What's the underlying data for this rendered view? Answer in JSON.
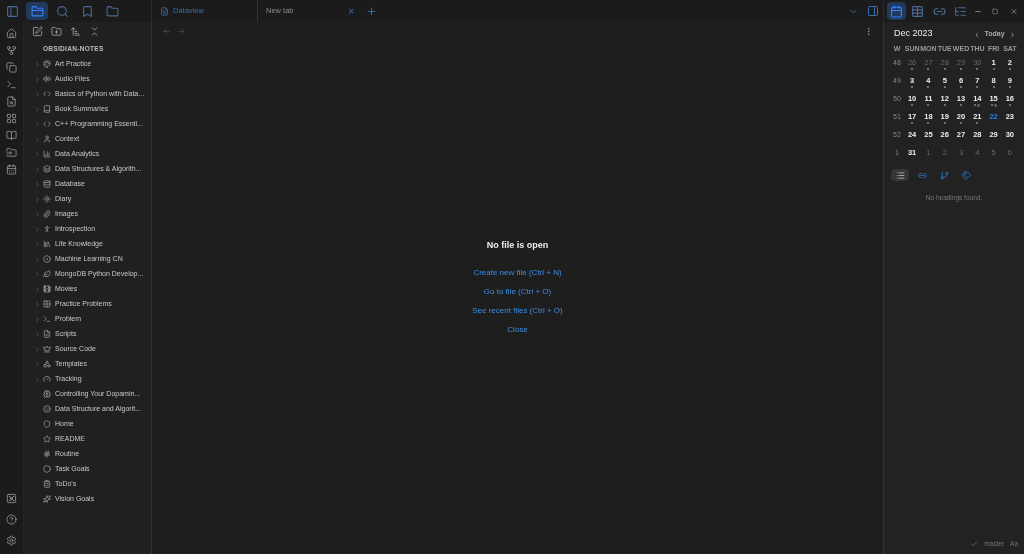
{
  "tabs": [
    {
      "label": "Dataview",
      "selected": false
    },
    {
      "label": "New tab",
      "selected": true,
      "close": "×"
    }
  ],
  "vault": {
    "name": "OBSIDIAN-NOTES"
  },
  "tree": [
    {
      "label": "Art Practice",
      "kind": "folder",
      "expanded": false
    },
    {
      "label": "Audio Files",
      "kind": "folder",
      "expanded": false
    },
    {
      "label": "Basics of Python with Data...",
      "kind": "folder",
      "expanded": false
    },
    {
      "label": "Book Summaries",
      "kind": "folder",
      "expanded": false
    },
    {
      "label": "C++ Programming Essenti...",
      "kind": "folder",
      "expanded": false
    },
    {
      "label": "Context",
      "kind": "folder",
      "expanded": false
    },
    {
      "label": "Data Analytics",
      "kind": "folder",
      "expanded": false
    },
    {
      "label": "Data Structures & Algorith...",
      "kind": "folder",
      "expanded": false
    },
    {
      "label": "Database",
      "kind": "folder",
      "expanded": false
    },
    {
      "label": "Diary",
      "kind": "folder",
      "expanded": false
    },
    {
      "label": "Images",
      "kind": "folder",
      "expanded": false
    },
    {
      "label": "Introspection",
      "kind": "folder",
      "expanded": false
    },
    {
      "label": "Life Knowledge",
      "kind": "folder",
      "expanded": false
    },
    {
      "label": "Machine Learning CN",
      "kind": "folder",
      "expanded": false
    },
    {
      "label": "MongoDB Python Develop...",
      "kind": "folder",
      "expanded": false
    },
    {
      "label": "Movies",
      "kind": "folder",
      "expanded": false
    },
    {
      "label": "Practice Problems",
      "kind": "folder",
      "expanded": false
    },
    {
      "label": "Problem",
      "kind": "folder",
      "expanded": false
    },
    {
      "label": "Scripts",
      "kind": "folder",
      "expanded": false
    },
    {
      "label": "Source Code",
      "kind": "folder",
      "expanded": false
    },
    {
      "label": "Templates",
      "kind": "folder",
      "expanded": false
    },
    {
      "label": "Tracking",
      "kind": "folder",
      "expanded": false
    },
    {
      "label": "Controlling Your Dopamin...",
      "kind": "file"
    },
    {
      "label": "Data Structure and Algorit...",
      "kind": "file"
    },
    {
      "label": "Home",
      "kind": "file"
    },
    {
      "label": "README",
      "kind": "file"
    },
    {
      "label": "Routine",
      "kind": "file"
    },
    {
      "label": "Task Goals",
      "kind": "file"
    },
    {
      "label": "ToDo's",
      "kind": "file"
    },
    {
      "label": "Vision Goals",
      "kind": "file"
    }
  ],
  "empty_state": {
    "title": "No file is open",
    "actions": [
      "Create new file (Ctrl + N)",
      "Go to file (Ctrl + O)",
      "See recent files (Ctrl + O)",
      "Close"
    ]
  },
  "calendar": {
    "month": "Dec 2023",
    "today_button": "Today",
    "prev": "‹",
    "next": "›",
    "headers": [
      "W",
      "SUN",
      "MON",
      "TUE",
      "WED",
      "THU",
      "FRI",
      "SAT"
    ],
    "weeks": [
      {
        "week": "48",
        "days": [
          {
            "day": "26",
            "in_month": false,
            "today": false,
            "note": true,
            "task": false
          },
          {
            "day": "27",
            "in_month": false,
            "today": false,
            "note": true,
            "task": false
          },
          {
            "day": "28",
            "in_month": false,
            "today": false,
            "note": true,
            "task": false
          },
          {
            "day": "29",
            "in_month": false,
            "today": false,
            "note": true,
            "task": false
          },
          {
            "day": "30",
            "in_month": false,
            "today": false,
            "note": true,
            "task": false
          },
          {
            "day": "1",
            "in_month": true,
            "today": false,
            "note": true,
            "task": false
          },
          {
            "day": "2",
            "in_month": true,
            "today": false,
            "note": true,
            "task": false
          }
        ]
      },
      {
        "week": "49",
        "days": [
          {
            "day": "3",
            "in_month": true,
            "today": false,
            "note": true,
            "task": false
          },
          {
            "day": "4",
            "in_month": true,
            "today": false,
            "note": true,
            "task": false
          },
          {
            "day": "5",
            "in_month": true,
            "today": false,
            "note": true,
            "task": false
          },
          {
            "day": "6",
            "in_month": true,
            "today": false,
            "note": true,
            "task": false
          },
          {
            "day": "7",
            "in_month": true,
            "today": false,
            "note": true,
            "task": false
          },
          {
            "day": "8",
            "in_month": true,
            "today": false,
            "note": true,
            "task": false
          },
          {
            "day": "9",
            "in_month": true,
            "today": false,
            "note": true,
            "task": false
          }
        ]
      },
      {
        "week": "50",
        "days": [
          {
            "day": "10",
            "in_month": true,
            "today": false,
            "note": true,
            "task": false
          },
          {
            "day": "11",
            "in_month": true,
            "today": false,
            "note": true,
            "task": false
          },
          {
            "day": "12",
            "in_month": true,
            "today": false,
            "note": true,
            "task": false
          },
          {
            "day": "13",
            "in_month": true,
            "today": false,
            "note": true,
            "task": false
          },
          {
            "day": "14",
            "in_month": true,
            "today": false,
            "note": true,
            "task": true
          },
          {
            "day": "15",
            "in_month": true,
            "today": false,
            "note": true,
            "task": true
          },
          {
            "day": "16",
            "in_month": true,
            "today": false,
            "note": true,
            "task": false
          }
        ]
      },
      {
        "week": "51",
        "days": [
          {
            "day": "17",
            "in_month": true,
            "today": false,
            "note": true,
            "task": false
          },
          {
            "day": "18",
            "in_month": true,
            "today": false,
            "note": true,
            "task": false
          },
          {
            "day": "19",
            "in_month": true,
            "today": false,
            "note": true,
            "task": false
          },
          {
            "day": "20",
            "in_month": true,
            "today": false,
            "note": true,
            "task": false
          },
          {
            "day": "21",
            "in_month": true,
            "today": false,
            "note": true,
            "task": false
          },
          {
            "day": "22",
            "in_month": true,
            "today": true,
            "note": false,
            "task": false
          },
          {
            "day": "23",
            "in_month": true,
            "today": false,
            "note": false,
            "task": false
          }
        ]
      },
      {
        "week": "52",
        "days": [
          {
            "day": "24",
            "in_month": true,
            "today": false,
            "note": false,
            "task": false
          },
          {
            "day": "25",
            "in_month": true,
            "today": false,
            "note": false,
            "task": false
          },
          {
            "day": "26",
            "in_month": true,
            "today": false,
            "note": false,
            "task": false
          },
          {
            "day": "27",
            "in_month": true,
            "today": false,
            "note": false,
            "task": false
          },
          {
            "day": "28",
            "in_month": true,
            "today": false,
            "note": false,
            "task": false
          },
          {
            "day": "29",
            "in_month": true,
            "today": false,
            "note": false,
            "task": false
          },
          {
            "day": "30",
            "in_month": true,
            "today": false,
            "note": false,
            "task": false
          }
        ]
      },
      {
        "week": "1",
        "days": [
          {
            "day": "31",
            "in_month": true,
            "today": false,
            "note": false,
            "task": false
          },
          {
            "day": "1",
            "in_month": false,
            "today": false,
            "note": false,
            "task": false
          },
          {
            "day": "2",
            "in_month": false,
            "today": false,
            "note": false,
            "task": false
          },
          {
            "day": "3",
            "in_month": false,
            "today": false,
            "note": false,
            "task": false
          },
          {
            "day": "4",
            "in_month": false,
            "today": false,
            "note": false,
            "task": false
          },
          {
            "day": "5",
            "in_month": false,
            "today": false,
            "note": false,
            "task": false
          },
          {
            "day": "6",
            "in_month": false,
            "today": false,
            "note": false,
            "task": false
          }
        ]
      }
    ]
  },
  "right_tabs": [
    {
      "selected": true
    },
    {
      "selected": false
    },
    {
      "selected": false
    },
    {
      "selected": false
    }
  ],
  "outline": {
    "message": "No headings found."
  },
  "status_bar": {
    "branch": "master",
    "font": "Aa"
  }
}
